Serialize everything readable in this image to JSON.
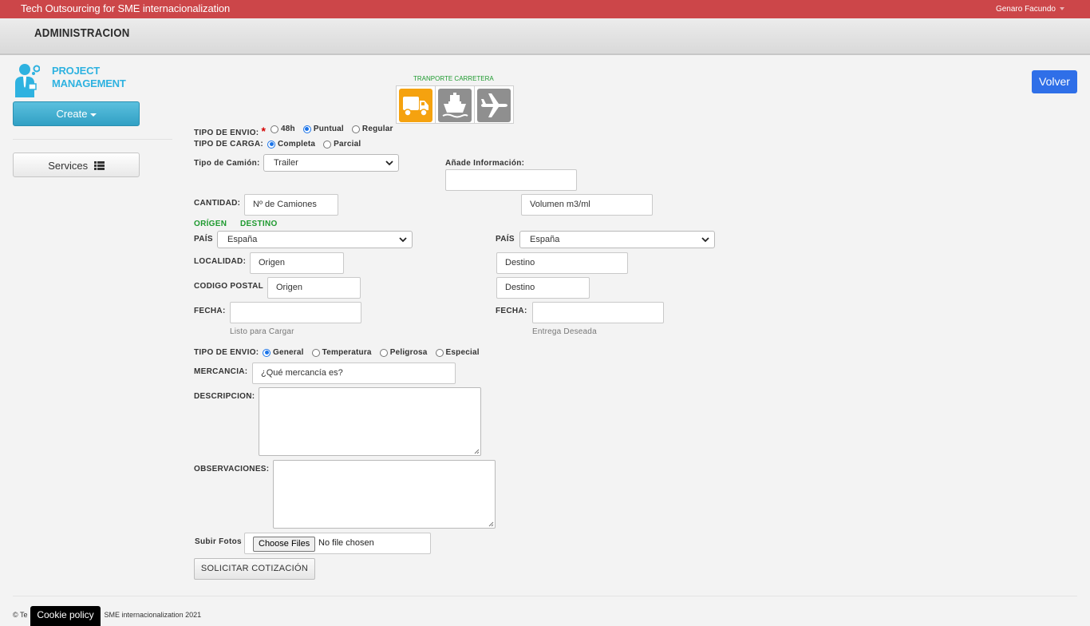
{
  "topbar": {
    "brand": "Tech Outsourcing for SME internacionalization",
    "user": "Genaro Facundo"
  },
  "adminbar": {
    "title": "ADMINISTRACION"
  },
  "sidebar": {
    "logo_line1": "PROJECT",
    "logo_line2": "MANAGEMENT",
    "create_label": "Create",
    "services_label": "Services"
  },
  "volver_label": "Volver",
  "transport": {
    "title": "TRANPORTE CARRETERA",
    "options": [
      {
        "icon": "truck-icon",
        "selected": true
      },
      {
        "icon": "ship-icon",
        "selected": false
      },
      {
        "icon": "plane-icon",
        "selected": false
      }
    ]
  },
  "form": {
    "tipo_envio_label": "TIPO DE ENVIO:",
    "tipo_envio_options": [
      "48h",
      "Puntual",
      "Regular"
    ],
    "tipo_envio_selected": "Puntual",
    "tipo_carga_label": "TIPO DE CARGA:",
    "tipo_carga_options": [
      "Completa",
      "Parcial"
    ],
    "tipo_carga_selected": "Completa",
    "tipo_camion_label": "Tipo de Camión:",
    "tipo_camion_value": "Trailer",
    "anade_info_label": "Añade Información:",
    "anade_info_value": "",
    "cantidad_label": "CANTIDAD:",
    "n_camiones_placeholder": "Nº de Camiones",
    "volumen_placeholder": "Volumen m3/ml",
    "origen_heading": "ORÍGEN",
    "destino_heading": "DESTINO",
    "pais_label": "PAÍS",
    "pais_origen": "España",
    "pais_destino": "España",
    "localidad_label": "LOCALIDAD:",
    "localidad_origen_placeholder": "Origen",
    "localidad_destino_placeholder": "Destino",
    "cp_label": "CODIGO POSTAL",
    "cp_origen_placeholder": "Origen",
    "cp_destino_placeholder": "Destino",
    "fecha_label": "FECHA:",
    "fecha_origen_hint": "Listo para Cargar",
    "fecha_destino_hint": "Entrega Deseada",
    "tipo_envio2_label": "TIPO DE ENVIO:",
    "tipo_envio2_options": [
      "General",
      "Temperatura",
      "Peligrosa",
      "Especial"
    ],
    "tipo_envio2_selected": "General",
    "mercancia_label": "MERCANCIA:",
    "mercancia_placeholder": "¿Qué mercancía es?",
    "descripcion_label": "DESCRIPCION:",
    "observaciones_label": "OBSERVACIONES:",
    "subir_fotos_label": "Subir Fotos",
    "choose_files_label": "Choose Files",
    "no_file_label": "No file chosen",
    "solicitar_label": "SOLICITAR COTIZACIÓN"
  },
  "footer": {
    "copyright_left": "© Te",
    "copyright_right": "SME internacionalization 2021",
    "cookie_label": "Cookie policy"
  }
}
